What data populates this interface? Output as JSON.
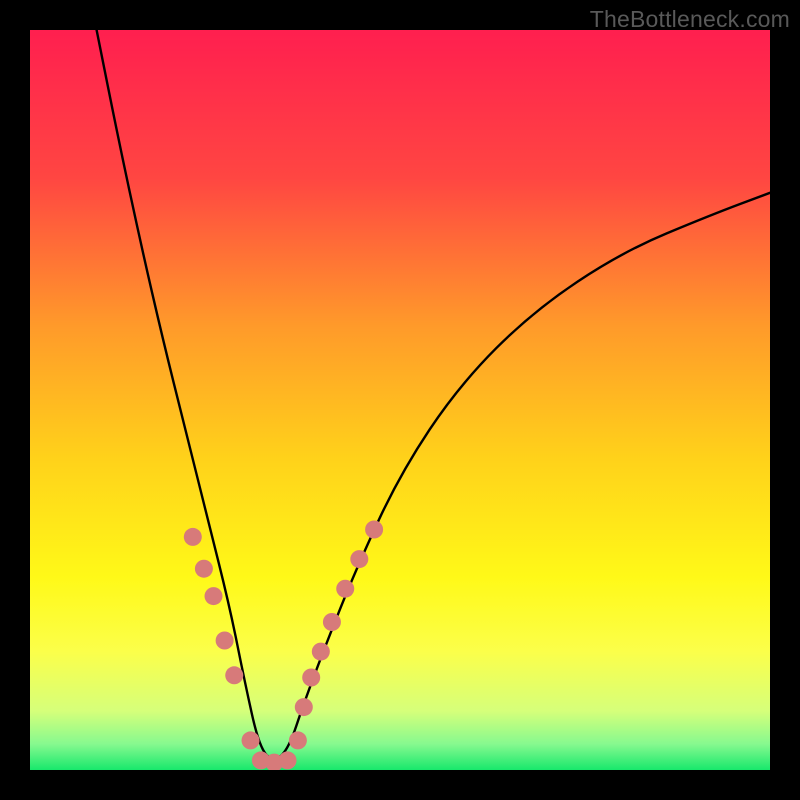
{
  "watermark": "TheBottleneck.com",
  "chart_data": {
    "type": "line",
    "title": "",
    "xlabel": "",
    "ylabel": "",
    "xlim": [
      0,
      100
    ],
    "ylim": [
      0,
      100
    ],
    "grid": false,
    "legend": false,
    "curve": {
      "name": "bottleneck-curve",
      "description": "Asymmetric V-shaped curve with minimum near x≈32, steep falling left branch and slower rising right branch (shape resembles √|x - 32| asymmetry).",
      "x": [
        9,
        12,
        15,
        18,
        21,
        24,
        27,
        29,
        31,
        33,
        35,
        37,
        40,
        44,
        50,
        58,
        68,
        80,
        92,
        100
      ],
      "y": [
        100,
        85,
        71,
        58,
        46,
        34,
        22,
        12,
        3,
        1,
        3,
        9,
        17,
        27,
        40,
        52,
        62,
        70,
        75,
        78
      ]
    },
    "markers": {
      "name": "dot-markers",
      "color": "#d77a7a",
      "radius_px": 9,
      "points": [
        {
          "x": 22.0,
          "y": 31.5
        },
        {
          "x": 23.5,
          "y": 27.2
        },
        {
          "x": 24.8,
          "y": 23.5
        },
        {
          "x": 26.3,
          "y": 17.5
        },
        {
          "x": 27.6,
          "y": 12.8
        },
        {
          "x": 29.8,
          "y": 4.0
        },
        {
          "x": 31.2,
          "y": 1.3
        },
        {
          "x": 33.0,
          "y": 1.0
        },
        {
          "x": 34.8,
          "y": 1.3
        },
        {
          "x": 36.2,
          "y": 4.0
        },
        {
          "x": 37.0,
          "y": 8.5
        },
        {
          "x": 38.0,
          "y": 12.5
        },
        {
          "x": 39.3,
          "y": 16.0
        },
        {
          "x": 40.8,
          "y": 20.0
        },
        {
          "x": 42.6,
          "y": 24.5
        },
        {
          "x": 44.5,
          "y": 28.5
        },
        {
          "x": 46.5,
          "y": 32.5
        }
      ]
    },
    "background_gradient": {
      "type": "vertical-linear",
      "stops": [
        {
          "pos": 0.0,
          "color": "#ff1f4f"
        },
        {
          "pos": 0.2,
          "color": "#ff4642"
        },
        {
          "pos": 0.4,
          "color": "#ff9a2a"
        },
        {
          "pos": 0.58,
          "color": "#ffd21a"
        },
        {
          "pos": 0.74,
          "color": "#fff918"
        },
        {
          "pos": 0.84,
          "color": "#fbff4a"
        },
        {
          "pos": 0.92,
          "color": "#d6ff7a"
        },
        {
          "pos": 0.965,
          "color": "#86f98f"
        },
        {
          "pos": 1.0,
          "color": "#18e86c"
        }
      ]
    }
  }
}
